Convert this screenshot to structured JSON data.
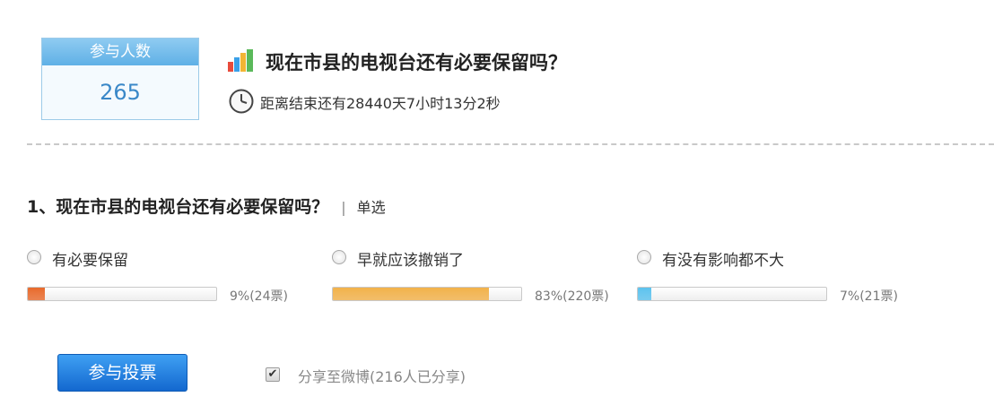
{
  "participants": {
    "label": "参与人数",
    "count": "265"
  },
  "poll": {
    "title": "现在市县的电视台还有必要保留吗？",
    "countdown": "距离结束还有28440天7小时13分2秒"
  },
  "question": {
    "text": "1、现在市县的电视台还有必要保留吗？",
    "separator": "|",
    "type": "单选"
  },
  "options": [
    {
      "label": "有必要保留",
      "percent": 9,
      "result_text": "9%(24票)",
      "color": "#e86a2c"
    },
    {
      "label": "早就应该撤销了",
      "percent": 83,
      "result_text": "83%(220票)",
      "color": "#f2b14a"
    },
    {
      "label": "有没有影响都不大",
      "percent": 7,
      "result_text": "7%(21票)",
      "color": "#5cc2ee"
    }
  ],
  "actions": {
    "vote_label": "参与投票",
    "share_checked": true,
    "share_label": "分享至微博(216人已分享)"
  },
  "colors": {
    "accent": "#1a74d6",
    "divider": "#c9c9c9"
  }
}
